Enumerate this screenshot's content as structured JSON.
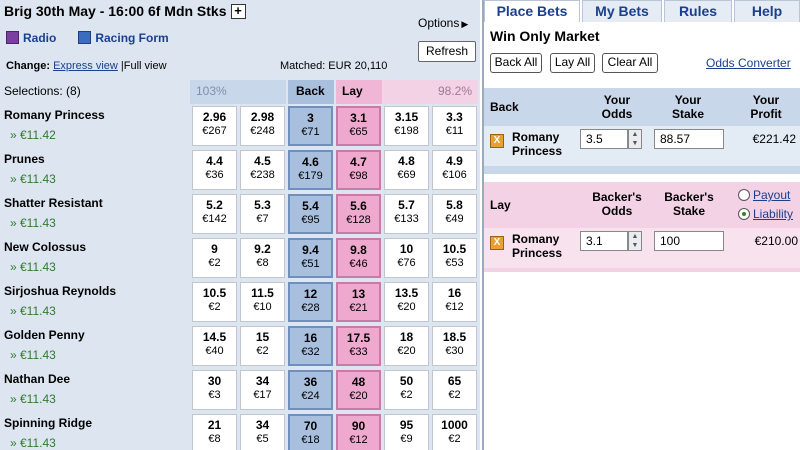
{
  "race": {
    "title": "Brig 30th May - 16:00 6f Mdn Stks",
    "plus": "+"
  },
  "links": {
    "radio": "Radio",
    "racing_form": "Racing Form"
  },
  "options": {
    "label": "Options"
  },
  "refresh": {
    "label": "Refresh"
  },
  "view": {
    "change_label": "Change:",
    "express": "Express view",
    "separator": "|",
    "full": "Full view"
  },
  "matched": {
    "text": "Matched: EUR 20,110"
  },
  "header": {
    "selections": "Selections: (8)",
    "back_pct": "103%",
    "back": "Back",
    "lay": "Lay",
    "lay_pct": "98.2%"
  },
  "runners": [
    {
      "name": "Romany Princess",
      "pl": "» €11.42",
      "prices": [
        {
          "o": "2.96",
          "a": "€267"
        },
        {
          "o": "2.98",
          "a": "€248"
        },
        {
          "o": "3",
          "a": "€71"
        },
        {
          "o": "3.1",
          "a": "€65"
        },
        {
          "o": "3.15",
          "a": "€198"
        },
        {
          "o": "3.3",
          "a": "€11"
        }
      ]
    },
    {
      "name": "Prunes",
      "pl": "» €11.43",
      "prices": [
        {
          "o": "4.4",
          "a": "€36"
        },
        {
          "o": "4.5",
          "a": "€238"
        },
        {
          "o": "4.6",
          "a": "€179"
        },
        {
          "o": "4.7",
          "a": "€98"
        },
        {
          "o": "4.8",
          "a": "€69"
        },
        {
          "o": "4.9",
          "a": "€106"
        }
      ]
    },
    {
      "name": "Shatter Resistant",
      "pl": "» €11.43",
      "prices": [
        {
          "o": "5.2",
          "a": "€142"
        },
        {
          "o": "5.3",
          "a": "€7"
        },
        {
          "o": "5.4",
          "a": "€95"
        },
        {
          "o": "5.6",
          "a": "€128"
        },
        {
          "o": "5.7",
          "a": "€133"
        },
        {
          "o": "5.8",
          "a": "€49"
        }
      ]
    },
    {
      "name": "New Colossus",
      "pl": "» €11.43",
      "prices": [
        {
          "o": "9",
          "a": "€2"
        },
        {
          "o": "9.2",
          "a": "€8"
        },
        {
          "o": "9.4",
          "a": "€51"
        },
        {
          "o": "9.8",
          "a": "€46"
        },
        {
          "o": "10",
          "a": "€76"
        },
        {
          "o": "10.5",
          "a": "€53"
        }
      ]
    },
    {
      "name": "Sirjoshua Reynolds",
      "pl": "» €11.43",
      "prices": [
        {
          "o": "10.5",
          "a": "€2"
        },
        {
          "o": "11.5",
          "a": "€10"
        },
        {
          "o": "12",
          "a": "€28"
        },
        {
          "o": "13",
          "a": "€21"
        },
        {
          "o": "13.5",
          "a": "€20"
        },
        {
          "o": "16",
          "a": "€12"
        }
      ]
    },
    {
      "name": "Golden Penny",
      "pl": "» €11.43",
      "prices": [
        {
          "o": "14.5",
          "a": "€40"
        },
        {
          "o": "15",
          "a": "€2"
        },
        {
          "o": "16",
          "a": "€32"
        },
        {
          "o": "17.5",
          "a": "€33"
        },
        {
          "o": "18",
          "a": "€20"
        },
        {
          "o": "18.5",
          "a": "€30"
        }
      ]
    },
    {
      "name": "Nathan Dee",
      "pl": "» €11.43",
      "prices": [
        {
          "o": "30",
          "a": "€3"
        },
        {
          "o": "34",
          "a": "€17"
        },
        {
          "o": "36",
          "a": "€24"
        },
        {
          "o": "48",
          "a": "€20"
        },
        {
          "o": "50",
          "a": "€2"
        },
        {
          "o": "65",
          "a": "€2"
        }
      ]
    },
    {
      "name": "Spinning Ridge",
      "pl": "» €11.43",
      "prices": [
        {
          "o": "21",
          "a": "€8"
        },
        {
          "o": "34",
          "a": "€5"
        },
        {
          "o": "70",
          "a": "€18"
        },
        {
          "o": "90",
          "a": "€12"
        },
        {
          "o": "95",
          "a": "€9"
        },
        {
          "o": "1000",
          "a": "€2"
        }
      ]
    }
  ],
  "tabs": [
    "Place Bets",
    "My Bets",
    "Rules",
    "Help"
  ],
  "betslip": {
    "market": "Win Only Market",
    "back_all": "Back All",
    "lay_all": "Lay All",
    "clear_all": "Clear All",
    "odds_converter": "Odds Converter",
    "back": {
      "label": "Back",
      "col_odds": "Your Odds",
      "col_stake": "Your Stake",
      "col_profit": "Your Profit",
      "selection": "Romany Princess",
      "odds": "3.5",
      "stake": "88.57",
      "profit": "€221.42"
    },
    "lay": {
      "label": "Lay",
      "col_odds": "Backer's Odds",
      "col_stake": "Backer's Stake",
      "payout": "Payout",
      "liability": "Liability",
      "selection": "Romany Princess",
      "odds": "3.1",
      "stake": "100",
      "liability_value": "€210.00"
    },
    "x": "X"
  }
}
